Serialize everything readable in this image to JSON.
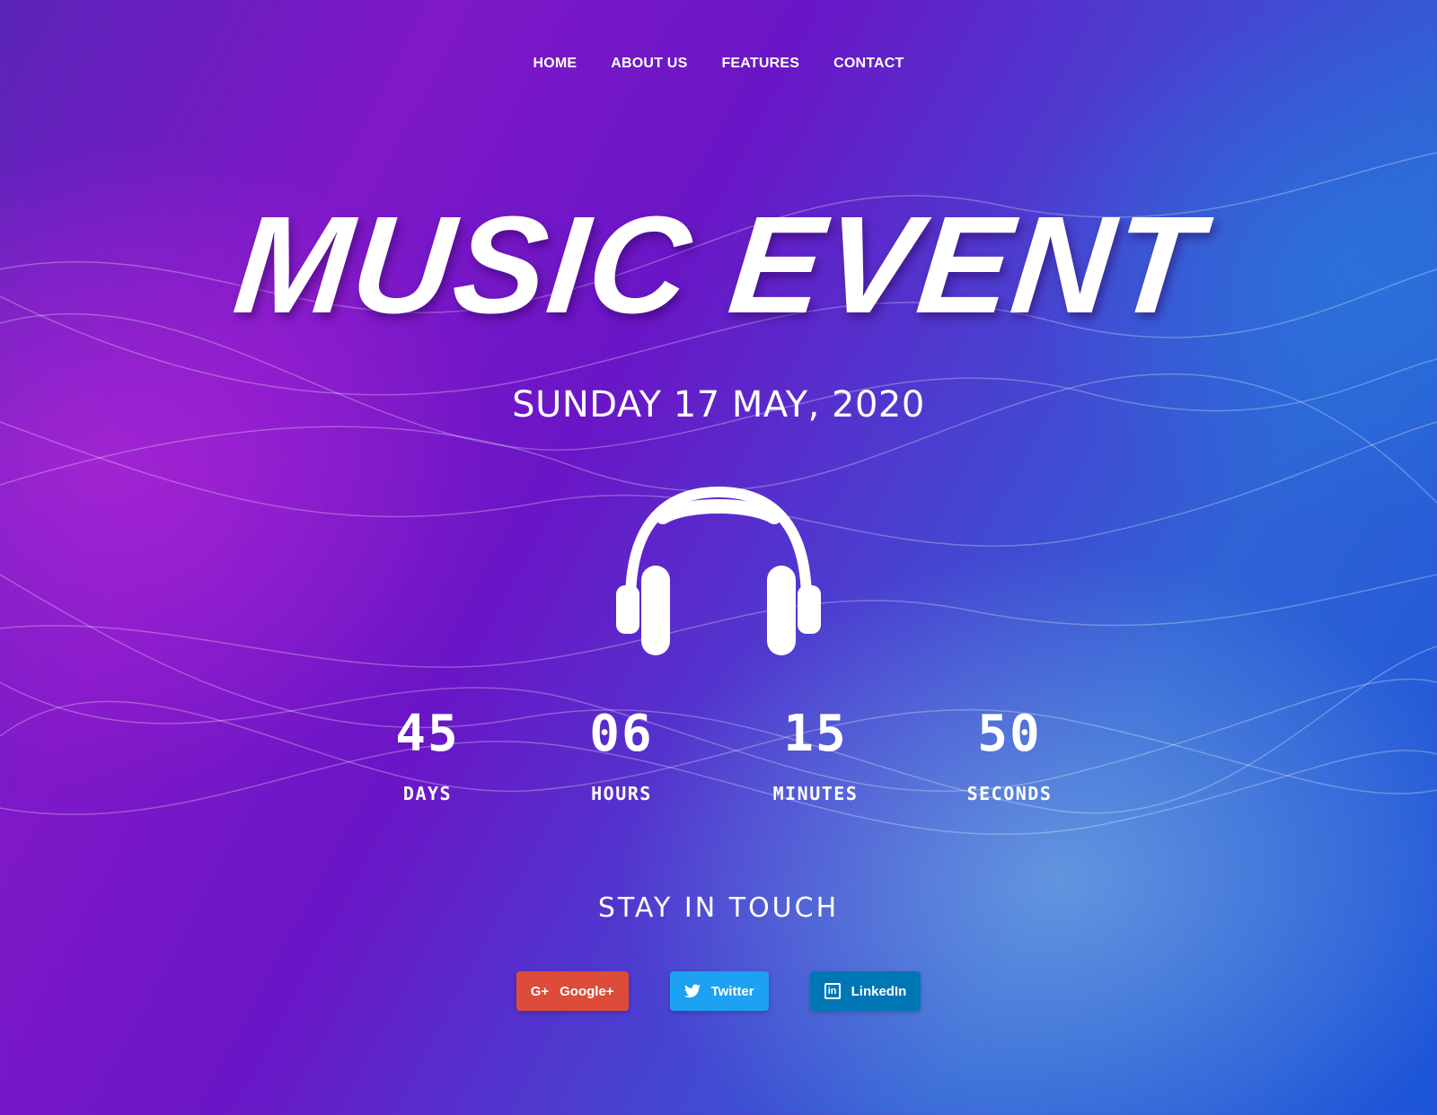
{
  "nav": {
    "items": [
      {
        "label": "HOME"
      },
      {
        "label": "ABOUT US"
      },
      {
        "label": "FEATURES"
      },
      {
        "label": "CONTACT"
      }
    ]
  },
  "hero": {
    "title": "MUSIC EVENT",
    "date": "SUNDAY 17 MAY, 2020",
    "icon": "headphones-icon"
  },
  "countdown": [
    {
      "value": "45",
      "label": "DAYS"
    },
    {
      "value": "06",
      "label": "HOURS"
    },
    {
      "value": "15",
      "label": "MINUTES"
    },
    {
      "value": "50",
      "label": "SECONDS"
    }
  ],
  "social": {
    "heading": "STAY IN TOUCH",
    "buttons": [
      {
        "label": "Google+",
        "icon": "google-plus-icon",
        "icon_text": "G+",
        "color": "#dd4b39"
      },
      {
        "label": "Twitter",
        "icon": "twitter-icon",
        "color": "#1da1f2"
      },
      {
        "label": "LinkedIn",
        "icon": "linkedin-icon",
        "icon_text": "in",
        "color": "#0077b5"
      }
    ]
  }
}
